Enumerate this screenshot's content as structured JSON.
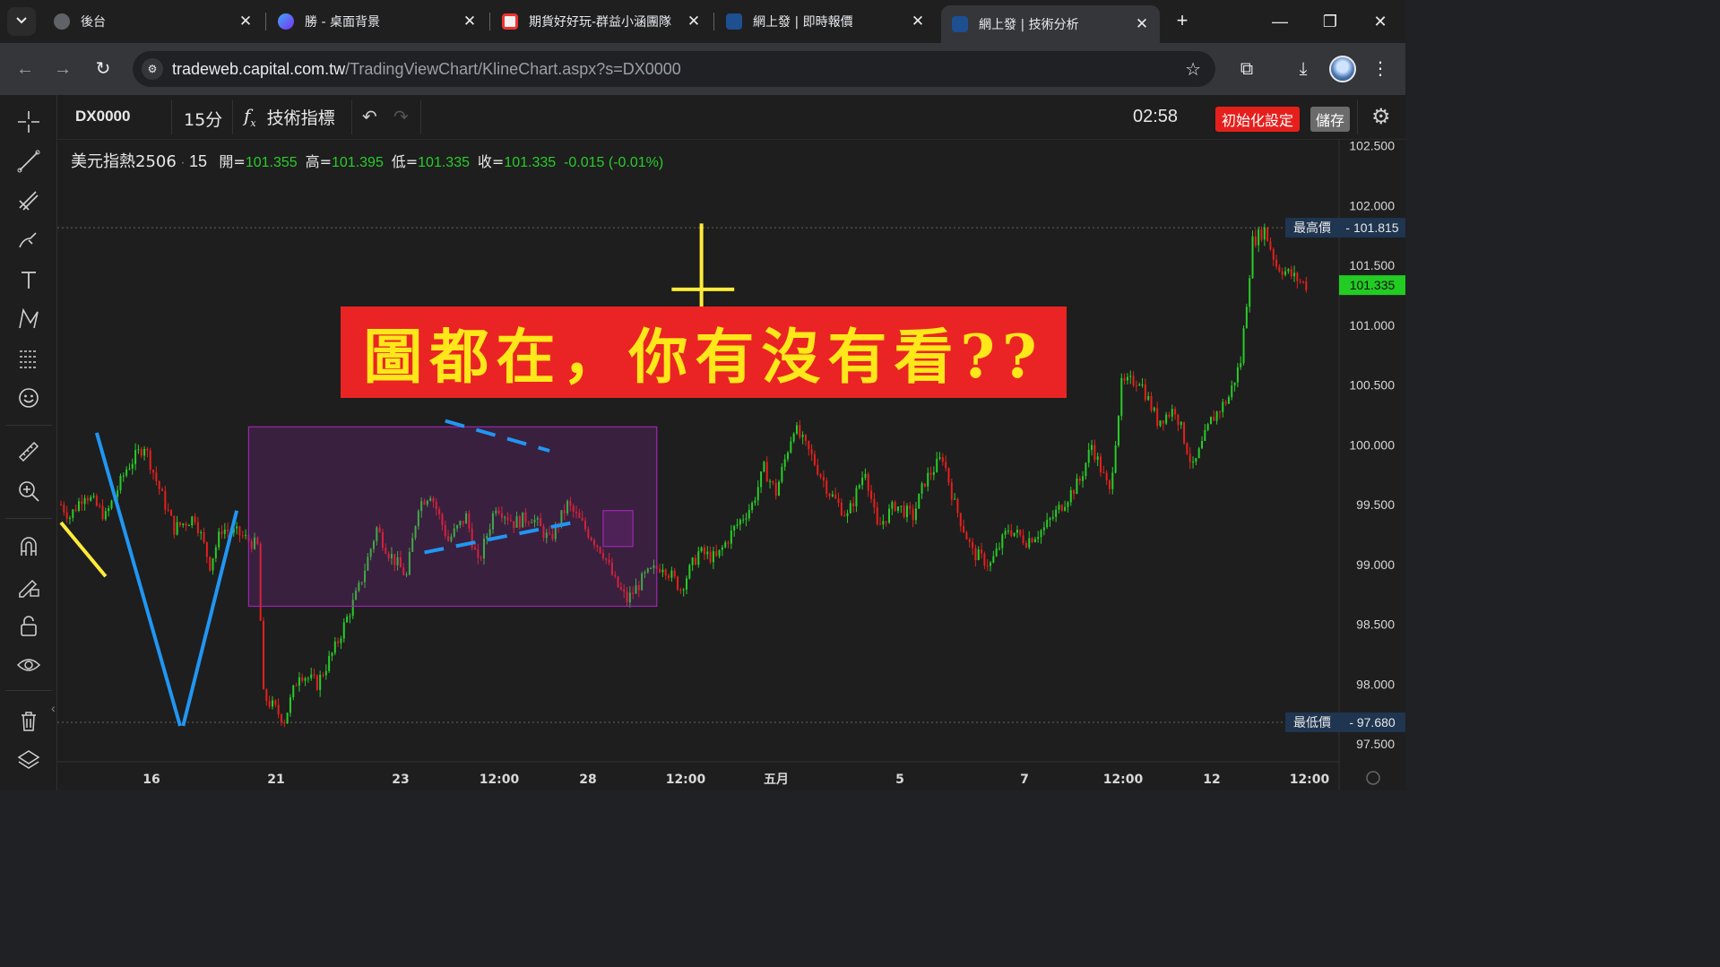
{
  "browser": {
    "tabs": [
      {
        "title": "後台",
        "icon": "cube-icon",
        "active": false
      },
      {
        "title": "勝 - 桌面背景",
        "icon": "c-logo-icon",
        "active": false
      },
      {
        "title": "期貨好好玩-群益小涵團隊",
        "icon": "group-icon",
        "active": false
      },
      {
        "title": "網上發 | 即時報價",
        "icon": "capital-logo-icon",
        "active": false
      },
      {
        "title": "網上發 | 技術分析",
        "icon": "capital-logo-icon",
        "active": true
      }
    ],
    "url_host": "tradeweb.capital.com.tw",
    "url_path": "/TradingViewChart/KlineChart.aspx?s=DX0000"
  },
  "chart_header": {
    "symbol": "DX0000",
    "interval": "15分",
    "indicators_label": "技術指標",
    "clock": "02:58",
    "reset_label": "初始化設定",
    "save_label": "儲存"
  },
  "legend": {
    "name": "美元指熱2506",
    "interval": "15",
    "open_label": "開=",
    "open": "101.355",
    "high_label": "高=",
    "high": "101.395",
    "low_label": "低=",
    "low": "101.335",
    "close_label": "收=",
    "close": "101.335",
    "change": "-0.015 (-0.01%)"
  },
  "overlay_caption": "圖都在，你有沒有看??",
  "price_markers": {
    "high_label": "最高價",
    "high_value": "101.815",
    "low_label": "最低價",
    "low_value": "97.680",
    "last_value": "101.335"
  },
  "colors": {
    "up": "#29cc29",
    "down": "#e5201c",
    "trend_blue": "#2196f3",
    "annot_yellow": "#ffeb3b",
    "box_purple": "#9c27b0",
    "caption_bg": "#ea2424",
    "caption_text": "#ffe71a"
  },
  "chart_data": {
    "type": "candlestick",
    "symbol": "美元指熱2506",
    "interval": "15",
    "y_ticks": [
      "102.500",
      "102.000",
      "101.500",
      "101.000",
      "100.500",
      "100.000",
      "99.500",
      "99.000",
      "98.500",
      "98.000",
      "97.500"
    ],
    "ylim": [
      97.35,
      102.55
    ],
    "x_ticks": [
      "16",
      "21",
      "23",
      "12:00",
      "28",
      "12:00",
      "五月",
      "5",
      "7",
      "12:00",
      "12",
      "12:00"
    ],
    "session_high": 101.815,
    "session_low": 97.68,
    "last_price": 101.335,
    "last_bar": {
      "open": 101.355,
      "high": 101.395,
      "low": 101.335,
      "close": 101.335
    },
    "price_path": [
      [
        0,
        99.5
      ],
      [
        3,
        99.4
      ],
      [
        8,
        99.6
      ],
      [
        15,
        99.4
      ],
      [
        22,
        99.8
      ],
      [
        28,
        100.0
      ],
      [
        32,
        99.7
      ],
      [
        38,
        99.3
      ],
      [
        45,
        99.4
      ],
      [
        50,
        99.0
      ],
      [
        54,
        99.3
      ],
      [
        60,
        99.25
      ],
      [
        66,
        99.15
      ],
      [
        68,
        97.9
      ],
      [
        75,
        97.7
      ],
      [
        80,
        98.1
      ],
      [
        86,
        98.0
      ],
      [
        92,
        98.3
      ],
      [
        100,
        98.8
      ],
      [
        106,
        99.3
      ],
      [
        110,
        99.1
      ],
      [
        116,
        98.9
      ],
      [
        120,
        99.5
      ],
      [
        124,
        99.6
      ],
      [
        130,
        99.2
      ],
      [
        136,
        99.4
      ],
      [
        140,
        99.0
      ],
      [
        146,
        99.5
      ],
      [
        152,
        99.35
      ],
      [
        158,
        99.4
      ],
      [
        164,
        99.2
      ],
      [
        170,
        99.5
      ],
      [
        176,
        99.3
      ],
      [
        182,
        99.1
      ],
      [
        186,
        98.85
      ],
      [
        190,
        98.7
      ],
      [
        196,
        98.9
      ],
      [
        202,
        99.0
      ],
      [
        208,
        98.8
      ],
      [
        214,
        99.1
      ],
      [
        220,
        99.05
      ],
      [
        226,
        99.3
      ],
      [
        232,
        99.5
      ],
      [
        236,
        99.8
      ],
      [
        240,
        99.6
      ],
      [
        246,
        100.15
      ],
      [
        252,
        99.9
      ],
      [
        258,
        99.6
      ],
      [
        264,
        99.4
      ],
      [
        270,
        99.8
      ],
      [
        274,
        99.3
      ],
      [
        280,
        99.5
      ],
      [
        286,
        99.4
      ],
      [
        290,
        99.7
      ],
      [
        296,
        99.9
      ],
      [
        300,
        99.5
      ],
      [
        306,
        99.1
      ],
      [
        312,
        99.0
      ],
      [
        318,
        99.3
      ],
      [
        324,
        99.2
      ],
      [
        330,
        99.3
      ],
      [
        336,
        99.5
      ],
      [
        342,
        99.7
      ],
      [
        346,
        100.0
      ],
      [
        352,
        99.6
      ],
      [
        356,
        100.5
      ],
      [
        362,
        100.55
      ],
      [
        368,
        100.2
      ],
      [
        374,
        100.3
      ],
      [
        380,
        99.8
      ],
      [
        386,
        100.2
      ],
      [
        392,
        100.4
      ],
      [
        396,
        100.7
      ],
      [
        400,
        101.7
      ],
      [
        404,
        101.8
      ],
      [
        408,
        101.5
      ],
      [
        414,
        101.4
      ],
      [
        418,
        101.335
      ]
    ]
  },
  "annotations": [
    {
      "type": "trendline",
      "color": "yellow",
      "from": [
        0,
        99.35
      ],
      "to": [
        15,
        98.9
      ]
    },
    {
      "type": "trendline",
      "color": "blue",
      "from": [
        12,
        100.1
      ],
      "to": [
        40,
        97.65
      ]
    },
    {
      "type": "trendline",
      "color": "blue",
      "from": [
        41,
        97.65
      ],
      "to": [
        59,
        99.45
      ]
    },
    {
      "type": "rectangle",
      "color": "purple",
      "from": [
        63,
        100.15
      ],
      "to": [
        200,
        98.65
      ]
    },
    {
      "type": "dashed-line",
      "color": "blue",
      "from": [
        129,
        100.2
      ],
      "to": [
        164,
        99.95
      ]
    },
    {
      "type": "dashed-line",
      "color": "blue",
      "from": [
        122,
        99.1
      ],
      "to": [
        172,
        99.35
      ]
    },
    {
      "type": "rectangle",
      "color": "purple",
      "from": [
        182,
        99.45
      ],
      "to": [
        192,
        99.15
      ]
    },
    {
      "type": "vertical-line",
      "color": "yellow",
      "at": [
        215,
        101.85
      ],
      "to": [
        215,
        100.4
      ]
    },
    {
      "type": "horizontal-line",
      "color": "yellow",
      "from": [
        205,
        101.3
      ],
      "to": [
        226,
        101.3
      ]
    }
  ]
}
